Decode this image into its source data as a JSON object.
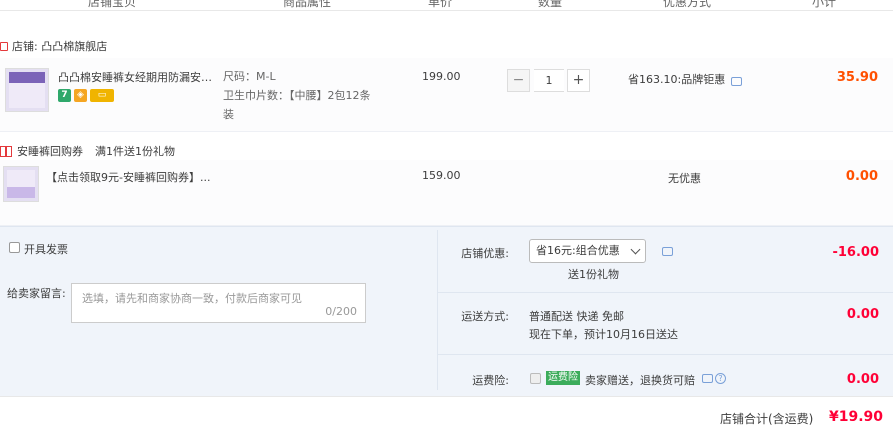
{
  "header": {
    "col_item": "店铺宝贝",
    "col_attrs": "商品属性",
    "col_price": "单价",
    "col_qty": "数量",
    "col_discount": "优惠方式",
    "col_subtotal": "小计"
  },
  "store": {
    "label": "店铺: 凸凸棉旗舰店"
  },
  "items": [
    {
      "title": "凸凸棉安睡裤女经期用防漏安心...",
      "attr_size": "尺码：M-L",
      "attr_pad": "卫生巾片数：【中腰】2包12条",
      "attr_pad_cont": "装",
      "price": "199.00",
      "qty": "1",
      "discount": "省163.10:品牌钜惠",
      "subtotal": "35.90",
      "badge_7": "7"
    },
    {
      "title": "【点击领取9元-安睡裤回购券】...",
      "price": "159.00",
      "discount": "无优惠",
      "subtotal": "0.00"
    }
  ],
  "gift": {
    "name": "安睡裤回购券",
    "rule": "满1件送1份礼物"
  },
  "invoice": {
    "label": "开具发票"
  },
  "message": {
    "label": "给卖家留言:",
    "placeholder": "选填，请先和商家协商一致，付款后商家可见",
    "counter": "0/200"
  },
  "store_discount": {
    "label": "店铺优惠:",
    "selected": "省16元:组合优惠",
    "note": "送1份礼物",
    "amount": "-16.00"
  },
  "shipping": {
    "label": "运送方式:",
    "method": "普通配送 快递 免邮",
    "eta": "现在下单，预计10月16日送达",
    "amount": "0.00"
  },
  "insurance": {
    "label": "运费险:",
    "tag": "运费险",
    "desc": "卖家赠送，退换货可赔",
    "amount": "0.00"
  },
  "total": {
    "label": "店铺合计(含运费)",
    "amount": "¥19.90"
  },
  "colors": {
    "accent_orange": "#ff5000",
    "accent_red": "#ff0036",
    "bg_bottom": "#f0f4fa",
    "tag_green": "#3cac5b"
  }
}
